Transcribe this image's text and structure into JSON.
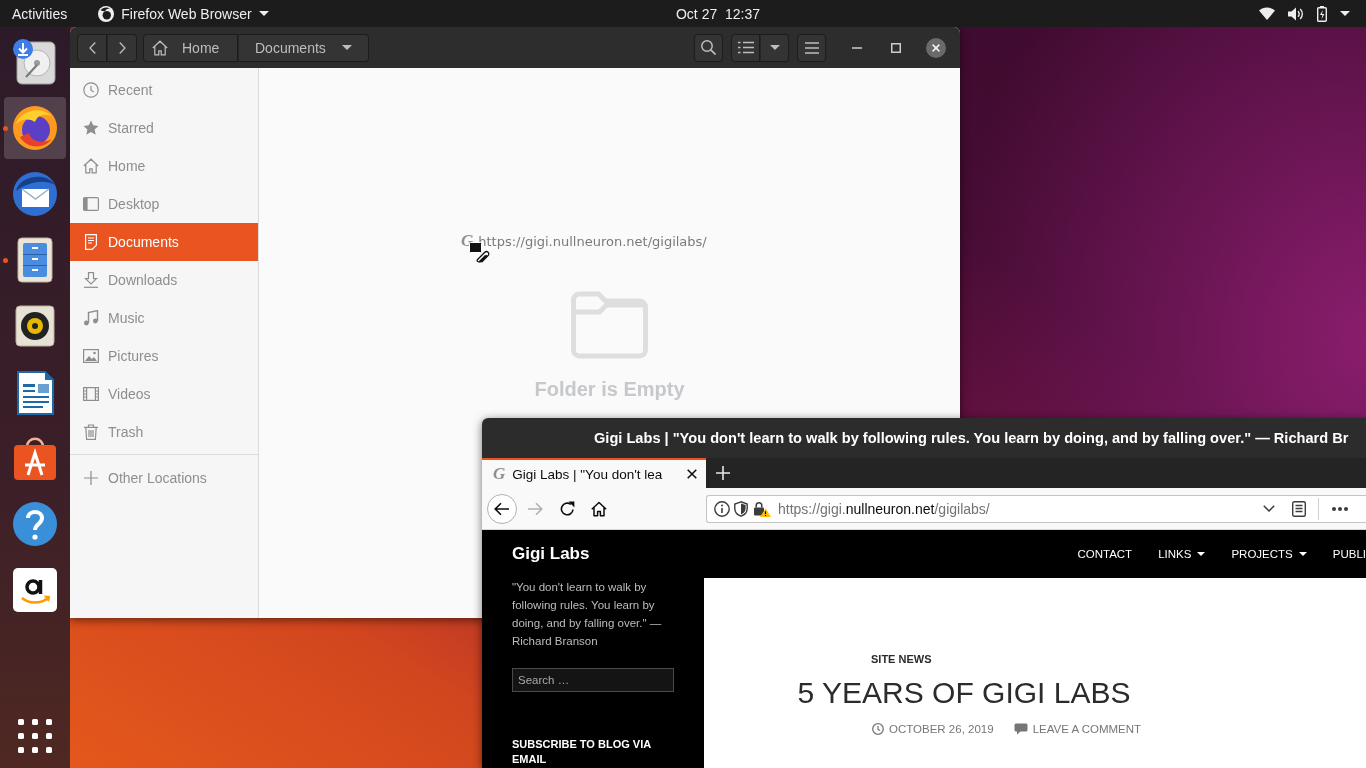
{
  "top_bar": {
    "activities": "Activities",
    "app_menu": "Firefox Web Browser",
    "clock": "Oct 27  12:37"
  },
  "dock": {
    "items": [
      {
        "kind": "drive",
        "running": false,
        "focused": false
      },
      {
        "kind": "browser",
        "running": true,
        "focused": true
      },
      {
        "kind": "mail",
        "running": false,
        "focused": false
      },
      {
        "kind": "files",
        "running": true,
        "focused": false
      },
      {
        "kind": "music",
        "running": false,
        "focused": false
      },
      {
        "kind": "writer",
        "running": false,
        "focused": false
      },
      {
        "kind": "store",
        "running": false,
        "focused": false
      },
      {
        "kind": "help",
        "running": false,
        "focused": false
      },
      {
        "kind": "shop",
        "running": false,
        "focused": false
      }
    ]
  },
  "files_window": {
    "path_bar": [
      {
        "label": "Home",
        "kind": "home"
      },
      {
        "label": "Documents",
        "kind": "menu"
      }
    ],
    "sidebar": {
      "items": [
        {
          "label": "Recent",
          "kind": "recent",
          "selected": false
        },
        {
          "label": "Starred",
          "kind": "starred",
          "selected": false
        },
        {
          "label": "Home",
          "kind": "home",
          "selected": false
        },
        {
          "label": "Desktop",
          "kind": "desktop",
          "selected": false
        },
        {
          "label": "Documents",
          "kind": "documents",
          "selected": true
        },
        {
          "label": "Downloads",
          "kind": "downloads",
          "selected": false
        },
        {
          "label": "Music",
          "kind": "music",
          "selected": false
        },
        {
          "label": "Pictures",
          "kind": "pictures",
          "selected": false
        },
        {
          "label": "Videos",
          "kind": "videos",
          "selected": false
        },
        {
          "label": "Trash",
          "kind": "trash",
          "selected": false
        }
      ],
      "other_items": [
        {
          "label": "Other Locations",
          "kind": "add",
          "selected": false
        }
      ]
    },
    "drag_preview": {
      "favicon": "G",
      "url": "https://gigi.nullneuron.net/gigilabs/"
    },
    "empty_message": "Folder is Empty"
  },
  "browser_window": {
    "title": "Gigi Labs | \"You don't learn to walk by following rules. You learn by doing, and by falling over.\" — Richard Br",
    "tabs": [
      {
        "favicon": "G",
        "title": "Gigi Labs | \"You don't lea",
        "selected": true
      }
    ],
    "toolbar": [
      {
        "kind": "back",
        "disabled": false
      },
      {
        "kind": "forward",
        "disabled": true
      },
      {
        "kind": "reload",
        "disabled": false
      },
      {
        "kind": "home",
        "disabled": false
      }
    ],
    "url": "https://gigi.**nullneuron.net**/gigilabs/",
    "page": {
      "site_title": "Gigi Labs",
      "nav": [
        {
          "label": "CONTACT",
          "has_menu": false
        },
        {
          "label": "LINKS",
          "has_menu": true
        },
        {
          "label": "PROJECTS",
          "has_menu": true
        },
        {
          "label": "PUBLI",
          "has_menu": false
        }
      ],
      "tagline": "\"You don't learn to walk by following rules. You learn by doing, and by falling over.\" — Richard Branson",
      "search": {
        "placeholder": "Search …"
      },
      "widget_title": "SUBSCRIBE TO BLOG VIA EMAIL",
      "post": {
        "category": "SITE NEWS",
        "title": "5 YEARS OF GIGI LABS",
        "date": "OCTOBER 26, 2019",
        "comments": "LEAVE A COMMENT"
      }
    }
  }
}
